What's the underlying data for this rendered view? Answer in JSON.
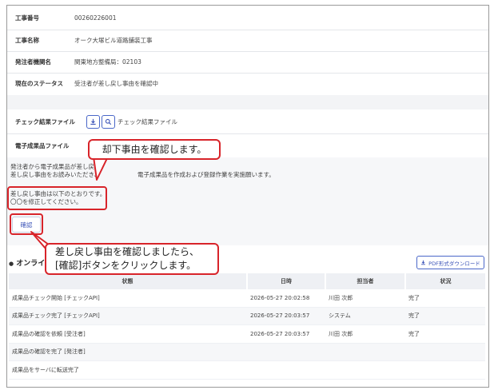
{
  "info": {
    "rows": [
      {
        "label": "工事番号",
        "value": "00260226001"
      },
      {
        "label": "工事名称",
        "value": "オーク大塚ビル道路舗装工事"
      },
      {
        "label": "発注者機関名",
        "value": "関東地方整備局：02103"
      },
      {
        "label": "現在のステータス",
        "value": "受注者が差し戻し事由を確認中"
      }
    ]
  },
  "files": {
    "check_result_label": "チェック結果ファイル",
    "check_result_file": "チェック結果ファイル",
    "electronic_label": "電子成果品ファイル"
  },
  "notice": {
    "line1": "発注者から電子成果品が差し戻さ",
    "line2a": "差し戻し事由をお読みいただき、",
    "line2b": "電子成果品を作成および登録作業を実施願います。",
    "reason_line1": "差し戻し事由は以下のとおりです。",
    "reason_line2": "〇〇を修正してください。"
  },
  "confirm_button": "確認",
  "callouts": {
    "top": "却下事由を確認します。",
    "bottom_line1": "差し戻し事由を確認しましたら、",
    "bottom_line2": "[確認]ボタンをクリックします。"
  },
  "history": {
    "title": "オンライ",
    "pdf_button": "PDF形式ダウンロード",
    "columns": [
      "状態",
      "日時",
      "担当者",
      "状況"
    ],
    "rows": [
      {
        "status": "成果品チェック開始 [チェックAPI]",
        "datetime": "2026-05-27 20:02:58",
        "person": "川田 次郎",
        "state": "完了"
      },
      {
        "status": "成果品チェック完了 [チェックAPI]",
        "datetime": "2026-05-27 20:03:57",
        "person": "システム",
        "state": "完了"
      },
      {
        "status": "成果品の確認を依頼 [受注者]",
        "datetime": "2026-05-27 20:03:57",
        "person": "川田 次郎",
        "state": "完了"
      },
      {
        "status": "成果品の確認を完了 [発注者]",
        "datetime": "",
        "person": "",
        "state": ""
      },
      {
        "status": "成果品をサーバに転送完了",
        "datetime": "",
        "person": "",
        "state": ""
      }
    ]
  }
}
